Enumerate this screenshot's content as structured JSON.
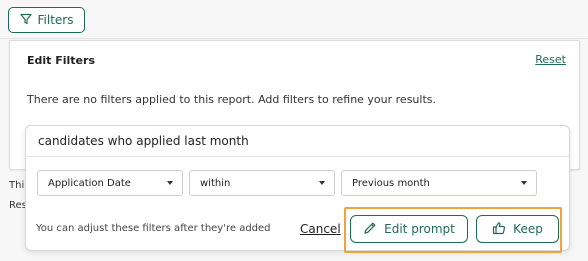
{
  "toolbar": {
    "filters_label": "Filters"
  },
  "background": {
    "left_text_1": "Thi",
    "left_text_2": "Res"
  },
  "panel": {
    "title": "Edit Filters",
    "reset_label": "Reset",
    "empty_message": "There are no filters applied to this report. Add filters to refine your results."
  },
  "prompt_card": {
    "prompt_text": "candidates who applied last month",
    "filters": [
      {
        "value": "Application Date"
      },
      {
        "value": "within"
      },
      {
        "value": "Previous month"
      }
    ],
    "hint": "You can adjust these filters after they're added",
    "cancel_label": "Cancel",
    "edit_prompt_label": "Edit prompt",
    "keep_label": "Keep"
  },
  "colors": {
    "accent": "#1f6b57",
    "highlight": "#f0a33a"
  },
  "icons": {
    "filters": "funnel-icon",
    "dropdown": "caret-down-icon",
    "edit_prompt": "pencil-icon",
    "keep": "thumbs-up-icon"
  }
}
